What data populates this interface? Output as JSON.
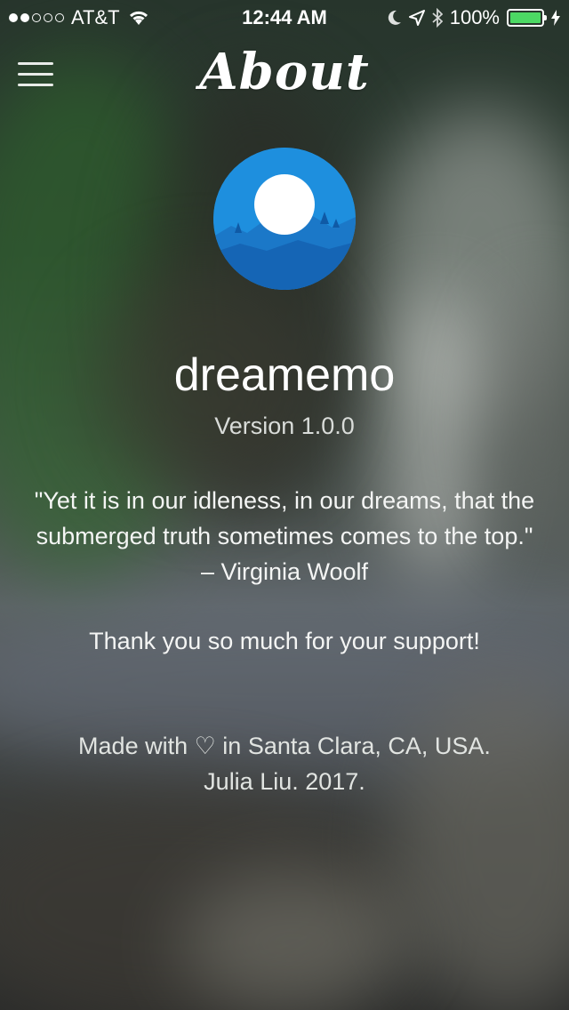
{
  "status_bar": {
    "carrier": "AT&T",
    "time": "12:44 AM",
    "battery_percent": "100%",
    "battery_level": 1.0,
    "signal_bars": 2,
    "icons": [
      "wifi-icon",
      "moon-icon",
      "location-arrow-icon",
      "bluetooth-icon",
      "charging-bolt-icon"
    ],
    "battery_color": "#4cd964"
  },
  "nav": {
    "title": "About",
    "menu_icon": "hamburger-menu-icon"
  },
  "app": {
    "name": "dreamemo",
    "version": "Version 1.0.0",
    "logo_colors": {
      "circle": "#1e8fde",
      "moon": "#ffffff",
      "hills": "#1565b5"
    }
  },
  "quote": "\"Yet it is in our idleness, in our dreams, that the submerged truth sometimes comes to the top.\" – Virginia Woolf",
  "thanks": "Thank you so much for your support!",
  "credits": {
    "line1": "Made with ♡ in Santa Clara, CA, USA.",
    "line2": "Julia Liu. 2017."
  }
}
